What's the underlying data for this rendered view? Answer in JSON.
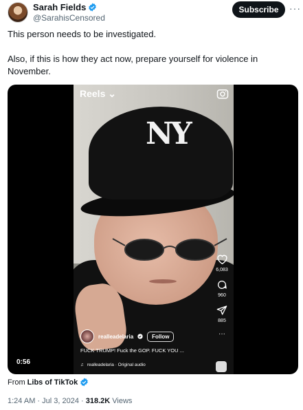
{
  "author": {
    "name": "Sarah Fields",
    "handle": "@SarahisCensored"
  },
  "header": {
    "subscribe_label": "Subscribe",
    "more_label": "···"
  },
  "tweet": {
    "line1": "This person needs to be investigated.",
    "line2": "Also, if this is how they act now, prepare yourself for violence in November."
  },
  "video": {
    "app_label": "Reels",
    "duration": "0:56",
    "likes": "6,083",
    "comments": "960",
    "shares": "885",
    "more": "···",
    "username": "realleadelaria",
    "follow_label": "Follow",
    "caption": "FUCK TRUMP! Fuck the GOP. FUCK YOU ...",
    "audio": "realleadelaria · Original audio",
    "cap_logo": "NY"
  },
  "source": {
    "prefix": "From",
    "account": "Libs of TikTok"
  },
  "meta": {
    "time": "1:24 AM · Jul 3, 2024 · ",
    "views_count": "318.2K",
    "views_label": " Views"
  },
  "colors": {
    "verified_blue": "#1d9bf0",
    "text": "#0f1419",
    "muted": "#536471"
  }
}
